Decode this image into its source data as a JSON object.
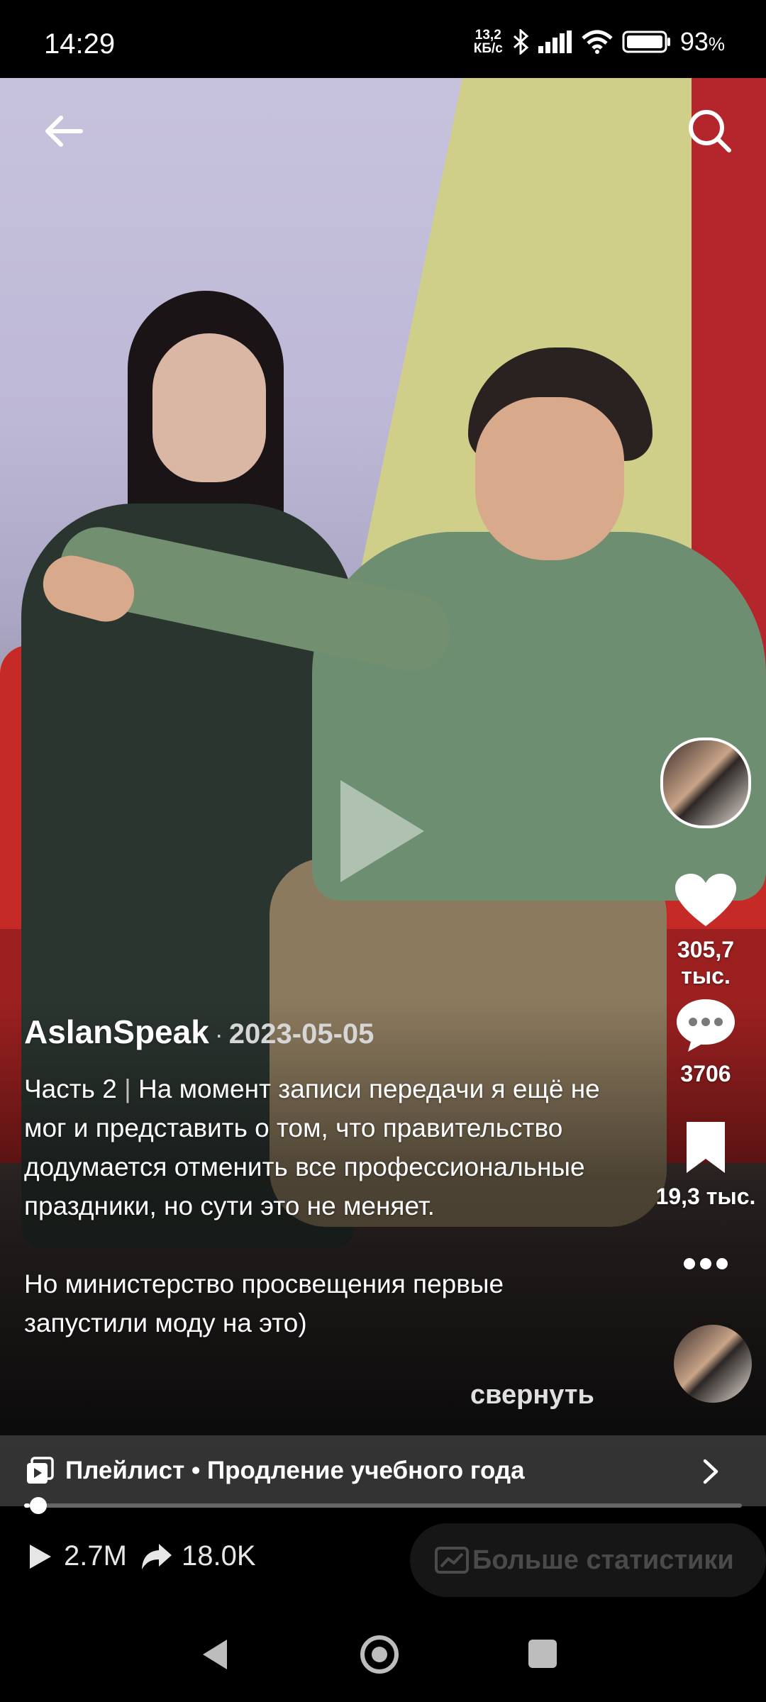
{
  "status_bar": {
    "time": "14:29",
    "net_speed_value": "13,2",
    "net_speed_unit": "КБ/с",
    "battery_percent": "93",
    "battery_suffix": "%"
  },
  "actions": {
    "likes": "305,7 тыс.",
    "comments": "3706",
    "saves": "19,3 тыс."
  },
  "post": {
    "author": "AslanSpeak",
    "separator": "·",
    "date": "2023-05-05",
    "caption_part": "Часть 2",
    "caption_divider": "|",
    "caption_paragraph1": "На момент записи передачи я ещё не мог и представить о том, что правительство додумается отменить все профессиональные праздники, но сути это не меняет.",
    "caption_paragraph2": "Но министерство просвещения первые запустили моду на это)",
    "collapse_label": "свернуть"
  },
  "playlist": {
    "label": "Плейлист • Продление учебного года"
  },
  "progress": {
    "fraction": 0.008
  },
  "stats": {
    "views": "2.7M",
    "shares": "18.0K",
    "more_label": "Больше статистики"
  },
  "icons": [
    "back-arrow-icon",
    "search-icon",
    "play-icon",
    "heart-icon",
    "comment-icon",
    "bookmark-icon",
    "more-icon",
    "playlist-icon",
    "chevron-right-icon",
    "views-play-icon",
    "share-icon",
    "chart-icon",
    "nav-back-icon",
    "nav-home-icon",
    "nav-recents-icon"
  ]
}
